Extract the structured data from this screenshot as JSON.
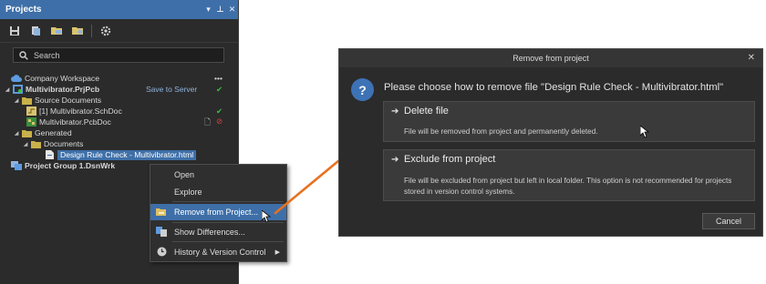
{
  "projects_panel": {
    "title": "Projects",
    "controls": [
      "▾",
      "⊥",
      "✕"
    ],
    "search_placeholder": "Search",
    "tree": {
      "workspace": "Company Workspace",
      "workspace_menu": "•••",
      "project": "Multivibrator.PrjPcb",
      "save_to_server": "Save to Server",
      "source_documents": "Source Documents",
      "schdoc": "[1] Multivibrator.SchDoc",
      "pcbdoc": "Multivibrator.PcbDoc",
      "generated": "Generated",
      "documents": "Documents",
      "selected_file": "Design Rule Check - Multivibrator.html",
      "project_group": "Project Group 1.DsnWrk"
    }
  },
  "context_menu": {
    "items": [
      {
        "label": "Open"
      },
      {
        "label": "Explore"
      },
      {
        "label": "Remove from Project..."
      },
      {
        "label": "Show Differences..."
      },
      {
        "label": "History & Version Control"
      }
    ]
  },
  "dialog": {
    "title": "Remove from project",
    "prompt": "Please choose how to remove file \"Design Rule Check - Multivibrator.html\"",
    "options": [
      {
        "title": "Delete file",
        "description": "File will be removed from project and permanently deleted."
      },
      {
        "title": "Exclude from project",
        "description": "File will be excluded from project but left in local folder. This option is not recommended for projects stored in version control systems."
      }
    ],
    "cancel_label": "Cancel"
  },
  "colors": {
    "accent": "#3e6fa8",
    "annotation_arrow": "#e8711f",
    "status_ok": "#3fbf3f",
    "status_error": "#e04040"
  }
}
